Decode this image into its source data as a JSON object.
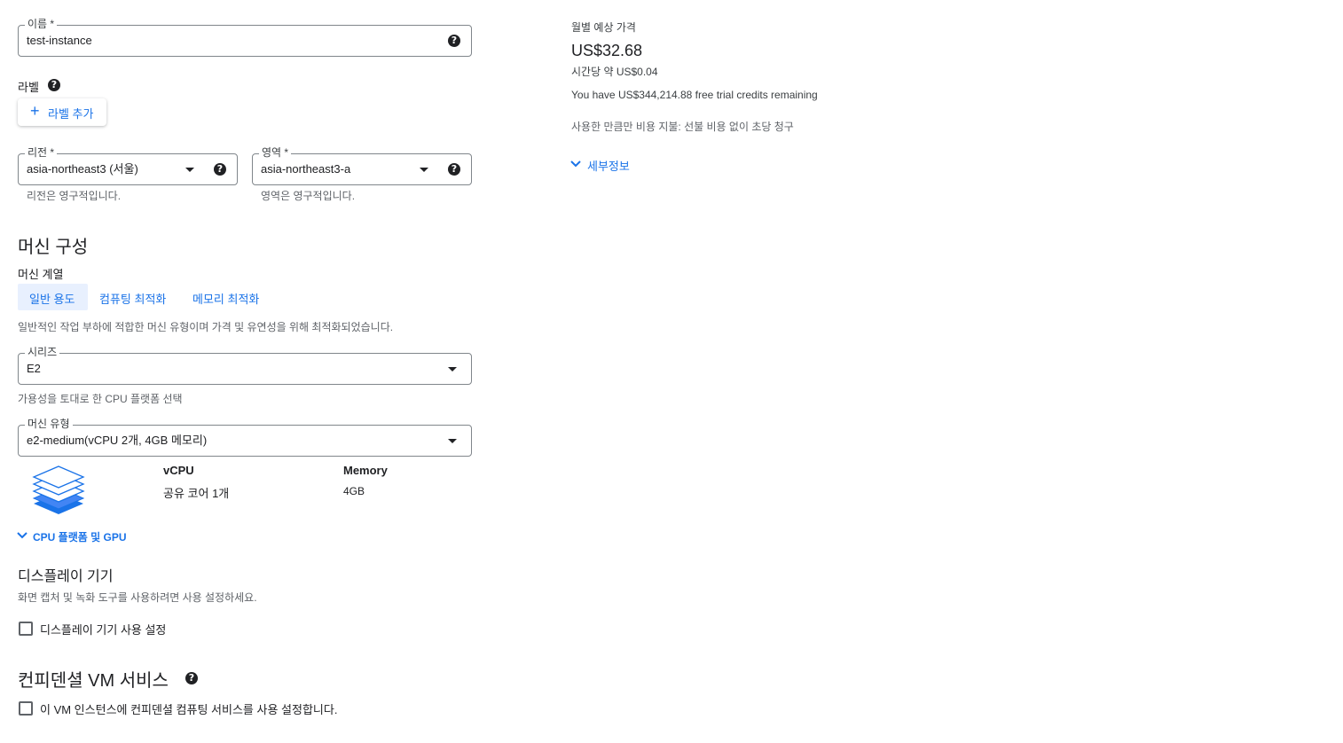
{
  "name_field": {
    "label": "이름 *",
    "value": "test-instance",
    "help_icon": "question-circle-icon"
  },
  "labels": {
    "title": "라벨",
    "add_button": "라벨 추가"
  },
  "region": {
    "label": "리전 *",
    "value": "asia-northeast3 (서울)",
    "hint": "리전은 영구적입니다."
  },
  "zone": {
    "label": "영역 *",
    "value": "asia-northeast3-a",
    "hint": "영역은 영구적입니다."
  },
  "machine_config": {
    "title": "머신 구성",
    "family_label": "머신 계열",
    "tabs": [
      {
        "label": "일반 용도",
        "selected": true
      },
      {
        "label": "컴퓨팅 최적화",
        "selected": false
      },
      {
        "label": "메모리 최적화",
        "selected": false
      }
    ],
    "family_description": "일반적인 작업 부하에 적합한 머신 유형이며 가격 및 유연성을 위해 최적화되었습니다.",
    "series": {
      "label": "시리즈",
      "value": "E2",
      "hint": "가용성을 토대로 한 CPU 플랫폼 선택"
    },
    "machine_type": {
      "label": "머신 유형",
      "value": "e2-medium(vCPU 2개, 4GB 메모리)"
    },
    "specs": {
      "vcpu_header": "vCPU",
      "vcpu_value": "공유 코어 1개",
      "memory_header": "Memory",
      "memory_value": "4GB"
    },
    "cpu_gpu_link": "CPU 플랫폼 및 GPU"
  },
  "display_device": {
    "title": "디스플레이 기기",
    "description": "화면 캡처 및 녹화 도구를 사용하려면 사용 설정하세요.",
    "checkbox_label": "디스플레이 기기 사용 설정",
    "checked": false
  },
  "confidential": {
    "title": "컨피덴셜 VM 서비스",
    "checkbox_label": "이 VM 인스턴스에 컨피덴셜 컴퓨팅 서비스를 사용 설정합니다.",
    "checked": false
  },
  "pricing": {
    "title": "월별 예상 가격",
    "monthly": "US$32.68",
    "hourly": "시간당 약 US$0.04",
    "credits": "You have US$344,214.88 free trial credits remaining",
    "billing_note": "사용한 만큼만 비용 지불: 선불 비용 없이 초당 청구",
    "details_link": "세부정보"
  },
  "colors": {
    "accent": "#1a73e8",
    "selected_tab_bg": "#e8f0fe",
    "border": "#80868b"
  }
}
